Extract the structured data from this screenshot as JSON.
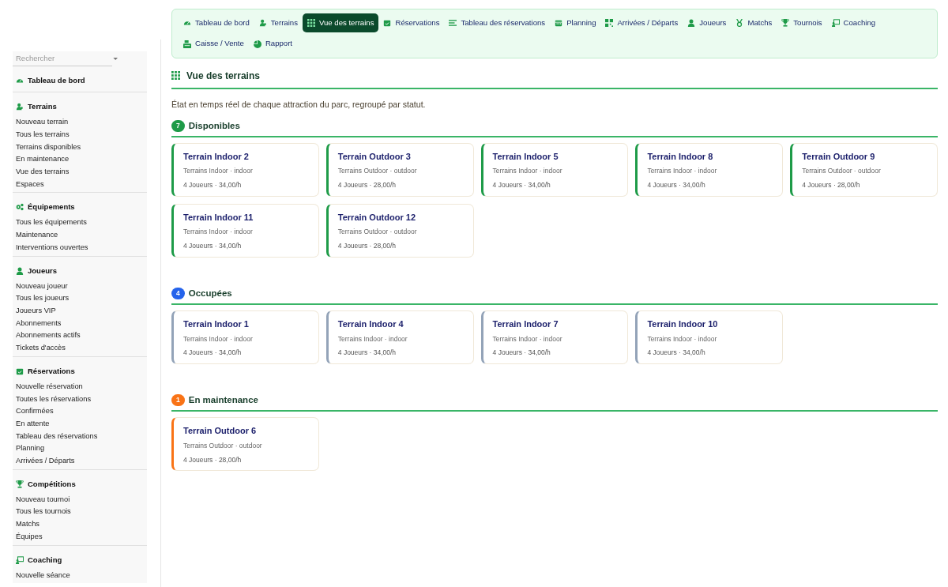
{
  "sidebar": {
    "search": {
      "placeholder": "Rechercher"
    },
    "sections": [
      {
        "title": "Tableau de bord"
      },
      {
        "title": "Terrains",
        "items": [
          "Nouveau terrain",
          "Tous les terrains",
          "Terrains disponibles",
          "En maintenance",
          "Vue des terrains",
          "Espaces"
        ]
      },
      {
        "title": "Équipements",
        "items": [
          "Tous les équipements",
          "Maintenance",
          "Interventions ouvertes"
        ]
      },
      {
        "title": "Joueurs",
        "items": [
          "Nouveau joueur",
          "Tous les joueurs",
          "Joueurs VIP",
          "Abonnements",
          "Abonnements actifs",
          "Tickets d'accès"
        ]
      },
      {
        "title": "Réservations",
        "items": [
          "Nouvelle réservation",
          "Toutes les réservations",
          "Confirmées",
          "En attente",
          "Tableau des réservations",
          "Planning",
          "Arrivées / Départs"
        ]
      },
      {
        "title": "Compétitions",
        "items": [
          "Nouveau tournoi",
          "Tous les tournois",
          "Matchs",
          "Équipes"
        ]
      },
      {
        "title": "Coaching",
        "items": [
          "Nouvelle séance"
        ]
      }
    ]
  },
  "tabs": [
    {
      "label": "Tableau de bord",
      "selected": false
    },
    {
      "label": "Terrains",
      "selected": false
    },
    {
      "label": "Vue des terrains",
      "selected": true
    },
    {
      "label": "Réservations",
      "selected": false
    },
    {
      "label": "Tableau des réservations",
      "selected": false
    },
    {
      "label": "Planning",
      "selected": false
    },
    {
      "label": "Arrivées / Départs",
      "selected": false
    },
    {
      "label": "Joueurs",
      "selected": false
    },
    {
      "label": "Matchs",
      "selected": false
    },
    {
      "label": "Tournois",
      "selected": false
    },
    {
      "label": "Coaching",
      "selected": false
    },
    {
      "label": "Caisse / Vente",
      "selected": false
    },
    {
      "label": "Rapport",
      "selected": false
    }
  ],
  "page": {
    "title": "Vue des terrains",
    "description": "État en temps réel de chaque attraction du parc, regroupé par statut."
  },
  "groups": [
    {
      "kind": "available",
      "count": "7",
      "title": "Disponibles",
      "color": "#1e9b48",
      "courts": [
        {
          "name": "Terrain Indoor 2",
          "category": "Terrains Indoor · indoor",
          "details": "4 Joueurs · 34,00/h"
        },
        {
          "name": "Terrain Outdoor 3",
          "category": "Terrains Outdoor · outdoor",
          "details": "4 Joueurs · 28,00/h"
        },
        {
          "name": "Terrain Indoor 5",
          "category": "Terrains Indoor · indoor",
          "details": "4 Joueurs · 34,00/h"
        },
        {
          "name": "Terrain Indoor 8",
          "category": "Terrains Indoor · indoor",
          "details": "4 Joueurs · 34,00/h"
        },
        {
          "name": "Terrain Outdoor 9",
          "category": "Terrains Outdoor · outdoor",
          "details": "4 Joueurs · 28,00/h"
        },
        {
          "name": "Terrain Indoor 11",
          "category": "Terrains Indoor · indoor",
          "details": "4 Joueurs · 34,00/h"
        },
        {
          "name": "Terrain Outdoor 12",
          "category": "Terrains Outdoor · outdoor",
          "details": "4 Joueurs · 28,00/h"
        }
      ]
    },
    {
      "kind": "occupied",
      "count": "4",
      "title": "Occupées",
      "color": "#2563eb",
      "courts": [
        {
          "name": "Terrain Indoor 1",
          "category": "Terrains Indoor · indoor",
          "details": "4 Joueurs · 34,00/h"
        },
        {
          "name": "Terrain Indoor 4",
          "category": "Terrains Indoor · indoor",
          "details": "4 Joueurs · 34,00/h"
        },
        {
          "name": "Terrain Indoor 7",
          "category": "Terrains Indoor · indoor",
          "details": "4 Joueurs · 34,00/h"
        },
        {
          "name": "Terrain Indoor 10",
          "category": "Terrains Indoor · indoor",
          "details": "4 Joueurs · 34,00/h"
        }
      ]
    },
    {
      "kind": "maintenance",
      "count": "1",
      "title": "En maintenance",
      "color": "#f97316",
      "courts": [
        {
          "name": "Terrain Outdoor 6",
          "category": "Terrains Outdoor · outdoor",
          "details": "4 Joueurs · 28,00/h"
        }
      ]
    }
  ]
}
